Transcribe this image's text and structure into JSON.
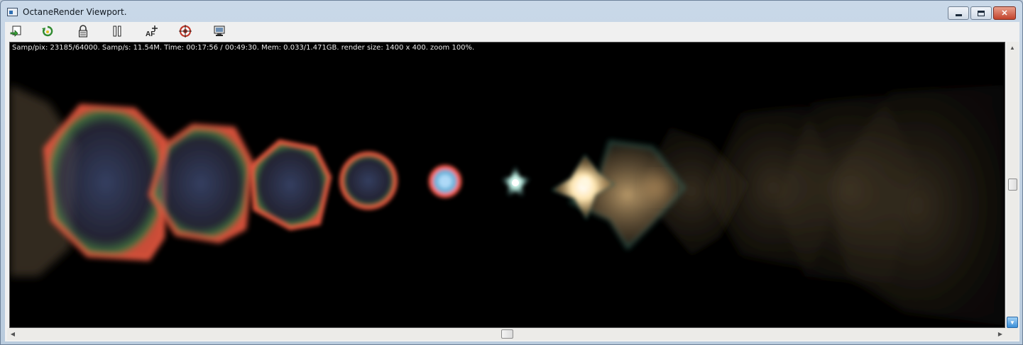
{
  "window": {
    "title": "OctaneRender Viewport."
  },
  "toolbar": {
    "tools": [
      {
        "icon": "send-to-viewport-icon"
      },
      {
        "icon": "restart-render-icon"
      },
      {
        "icon": "lock-icon"
      },
      {
        "icon": "pause-icon"
      },
      {
        "icon": "autofocus-icon"
      },
      {
        "icon": "pick-focus-icon"
      },
      {
        "icon": "display-settings-icon"
      }
    ]
  },
  "viewport": {
    "status": "Samp/pix: 23185/64000.  Samp/s: 11.54M.  Time: 00:17:56 / 00:49:30.  Mem: 0.033/1.471GB.  render size: 1400 x 400.  zoom 100%."
  },
  "scrollbars": {
    "vertical": {
      "position": 0.49
    },
    "horizontal": {
      "position": 0.5
    }
  }
}
